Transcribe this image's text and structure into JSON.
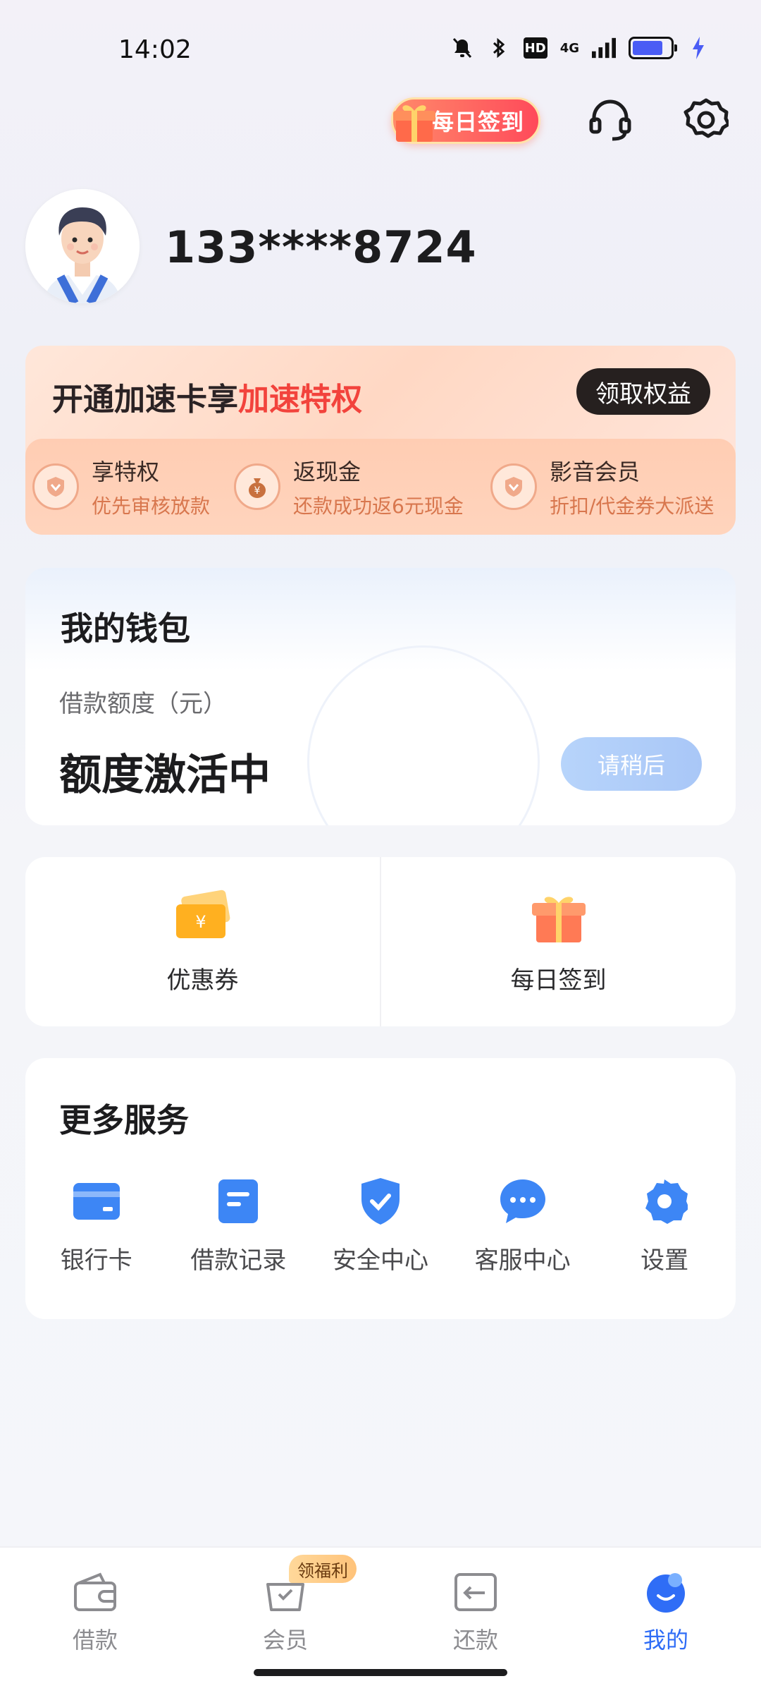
{
  "status_bar": {
    "time": "14:02",
    "network": "4G"
  },
  "header": {
    "signin_label": "每日签到"
  },
  "profile": {
    "phone": "133****8724"
  },
  "accelerate": {
    "title_prefix": "开通加速卡享",
    "title_highlight": "加速特权",
    "button": "领取权益",
    "perks": [
      {
        "title": "享特权",
        "desc": "优先审核放款"
      },
      {
        "title": "返现金",
        "desc": "还款成功返6元现金"
      },
      {
        "title": "影音会员",
        "desc": "折扣/代金券大派送"
      }
    ]
  },
  "wallet": {
    "title": "我的钱包",
    "subtitle": "借款额度（元）",
    "state": "额度激活中",
    "button": "请稍后"
  },
  "quick": [
    {
      "label": "优惠券",
      "icon": "coupon-icon"
    },
    {
      "label": "每日签到",
      "icon": "gift-icon"
    }
  ],
  "services": {
    "title": "更多服务",
    "items": [
      {
        "label": "银行卡",
        "icon": "bank-card-icon"
      },
      {
        "label": "借款记录",
        "icon": "record-icon"
      },
      {
        "label": "安全中心",
        "icon": "shield-icon"
      },
      {
        "label": "客服中心",
        "icon": "chat-icon"
      },
      {
        "label": "设置",
        "icon": "gear-icon"
      }
    ]
  },
  "nav": {
    "badge": "领福利",
    "items": [
      {
        "label": "借款",
        "icon": "wallet-icon"
      },
      {
        "label": "会员",
        "icon": "basket-icon"
      },
      {
        "label": "还款",
        "icon": "repay-icon"
      },
      {
        "label": "我的",
        "icon": "profile-icon"
      }
    ]
  },
  "colors": {
    "accent": "#2f6df6",
    "highlight": "#f2433c",
    "perk_desc": "#d8774e"
  }
}
